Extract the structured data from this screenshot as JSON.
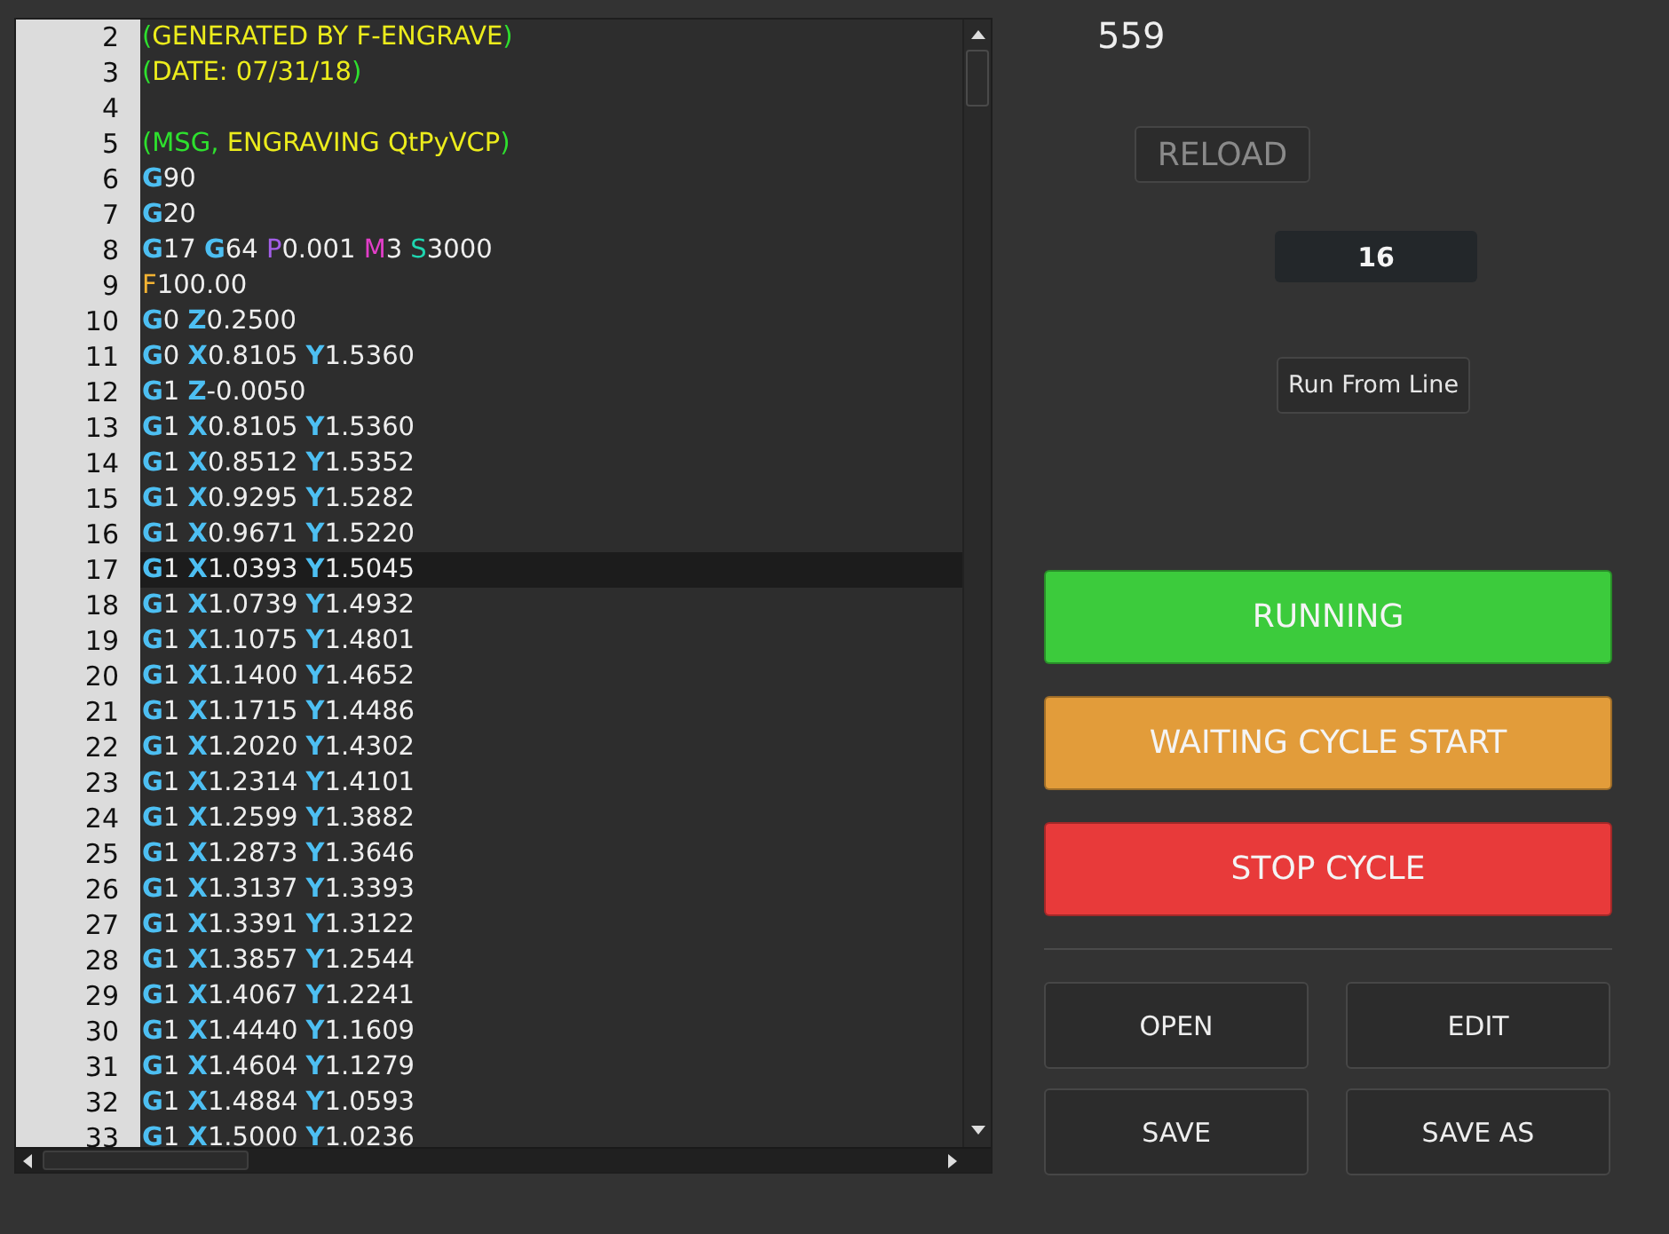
{
  "editor": {
    "lines": [
      {
        "number": "2",
        "selected": false,
        "tokens": [
          {
            "kind": "paren",
            "text": "("
          },
          {
            "kind": "comment",
            "text": "GENERATED BY F-ENGRAVE"
          },
          {
            "kind": "paren",
            "text": ")"
          }
        ]
      },
      {
        "number": "3",
        "selected": false,
        "tokens": [
          {
            "kind": "paren",
            "text": "("
          },
          {
            "kind": "comment",
            "text": "DATE: 07/31/18"
          },
          {
            "kind": "paren",
            "text": ")"
          }
        ]
      },
      {
        "number": "4",
        "selected": false
      },
      {
        "number": "5",
        "selected": false,
        "tokens": [
          {
            "kind": "paren",
            "text": "(MSG,"
          },
          {
            "kind": "comment",
            "text": " ENGRAVING QtPyVCP"
          },
          {
            "kind": "paren",
            "text": ")"
          }
        ]
      },
      {
        "number": "6",
        "selected": false,
        "tokens": [
          {
            "kind": "axis",
            "text": "G"
          },
          {
            "kind": "value",
            "text": "90"
          }
        ]
      },
      {
        "number": "7",
        "selected": false,
        "tokens": [
          {
            "kind": "axis",
            "text": "G"
          },
          {
            "kind": "value",
            "text": "20"
          }
        ]
      },
      {
        "number": "8",
        "selected": false,
        "tokens": [
          {
            "kind": "axis",
            "text": "G"
          },
          {
            "kind": "value",
            "text": "17 "
          },
          {
            "kind": "axis",
            "text": "G"
          },
          {
            "kind": "value",
            "text": "64 "
          },
          {
            "kind": "p",
            "text": "P"
          },
          {
            "kind": "value",
            "text": "0.001 "
          },
          {
            "kind": "m",
            "text": "M"
          },
          {
            "kind": "value",
            "text": "3 "
          },
          {
            "kind": "s",
            "text": "S"
          },
          {
            "kind": "value",
            "text": "3000"
          }
        ]
      },
      {
        "number": "9",
        "selected": false,
        "tokens": [
          {
            "kind": "f",
            "text": "F"
          },
          {
            "kind": "value",
            "text": "100.00"
          }
        ]
      },
      {
        "number": "10",
        "selected": false,
        "tokens": [
          {
            "kind": "axis",
            "text": "G"
          },
          {
            "kind": "value",
            "text": "0 "
          },
          {
            "kind": "axis",
            "text": "Z"
          },
          {
            "kind": "value",
            "text": "0.2500"
          }
        ]
      },
      {
        "number": "11",
        "selected": false,
        "tokens": [
          {
            "kind": "axis",
            "text": "G"
          },
          {
            "kind": "value",
            "text": "0 "
          },
          {
            "kind": "axis",
            "text": "X"
          },
          {
            "kind": "value",
            "text": "0.8105 "
          },
          {
            "kind": "axis",
            "text": "Y"
          },
          {
            "kind": "value",
            "text": "1.5360"
          }
        ]
      },
      {
        "number": "12",
        "selected": false,
        "tokens": [
          {
            "kind": "axis",
            "text": "G"
          },
          {
            "kind": "value",
            "text": "1 "
          },
          {
            "kind": "axis",
            "text": "Z"
          },
          {
            "kind": "value",
            "text": "-0.0050"
          }
        ]
      },
      {
        "number": "13",
        "selected": false,
        "tokens": [
          {
            "kind": "axis",
            "text": "G"
          },
          {
            "kind": "value",
            "text": "1 "
          },
          {
            "kind": "axis",
            "text": "X"
          },
          {
            "kind": "value",
            "text": "0.8105 "
          },
          {
            "kind": "axis",
            "text": "Y"
          },
          {
            "kind": "value",
            "text": "1.5360"
          }
        ]
      },
      {
        "number": "14",
        "selected": false,
        "tokens": [
          {
            "kind": "axis",
            "text": "G"
          },
          {
            "kind": "value",
            "text": "1 "
          },
          {
            "kind": "axis",
            "text": "X"
          },
          {
            "kind": "value",
            "text": "0.8512 "
          },
          {
            "kind": "axis",
            "text": "Y"
          },
          {
            "kind": "value",
            "text": "1.5352"
          }
        ]
      },
      {
        "number": "15",
        "selected": false,
        "tokens": [
          {
            "kind": "axis",
            "text": "G"
          },
          {
            "kind": "value",
            "text": "1 "
          },
          {
            "kind": "axis",
            "text": "X"
          },
          {
            "kind": "value",
            "text": "0.9295 "
          },
          {
            "kind": "axis",
            "text": "Y"
          },
          {
            "kind": "value",
            "text": "1.5282"
          }
        ]
      },
      {
        "number": "16",
        "selected": false,
        "tokens": [
          {
            "kind": "axis",
            "text": "G"
          },
          {
            "kind": "value",
            "text": "1 "
          },
          {
            "kind": "axis",
            "text": "X"
          },
          {
            "kind": "value",
            "text": "0.9671 "
          },
          {
            "kind": "axis",
            "text": "Y"
          },
          {
            "kind": "value",
            "text": "1.5220"
          }
        ]
      },
      {
        "number": "17",
        "selected": true,
        "tokens": [
          {
            "kind": "axis",
            "text": "G"
          },
          {
            "kind": "value",
            "text": "1 "
          },
          {
            "kind": "axis",
            "text": "X"
          },
          {
            "kind": "value",
            "text": "1.0393 "
          },
          {
            "kind": "axis",
            "text": "Y"
          },
          {
            "kind": "value",
            "text": "1.5045"
          }
        ]
      },
      {
        "number": "18",
        "selected": false,
        "tokens": [
          {
            "kind": "axis",
            "text": "G"
          },
          {
            "kind": "value",
            "text": "1 "
          },
          {
            "kind": "axis",
            "text": "X"
          },
          {
            "kind": "value",
            "text": "1.0739 "
          },
          {
            "kind": "axis",
            "text": "Y"
          },
          {
            "kind": "value",
            "text": "1.4932"
          }
        ]
      },
      {
        "number": "19",
        "selected": false,
        "tokens": [
          {
            "kind": "axis",
            "text": "G"
          },
          {
            "kind": "value",
            "text": "1 "
          },
          {
            "kind": "axis",
            "text": "X"
          },
          {
            "kind": "value",
            "text": "1.1075 "
          },
          {
            "kind": "axis",
            "text": "Y"
          },
          {
            "kind": "value",
            "text": "1.4801"
          }
        ]
      },
      {
        "number": "20",
        "selected": false,
        "tokens": [
          {
            "kind": "axis",
            "text": "G"
          },
          {
            "kind": "value",
            "text": "1 "
          },
          {
            "kind": "axis",
            "text": "X"
          },
          {
            "kind": "value",
            "text": "1.1400 "
          },
          {
            "kind": "axis",
            "text": "Y"
          },
          {
            "kind": "value",
            "text": "1.4652"
          }
        ]
      },
      {
        "number": "21",
        "selected": false,
        "tokens": [
          {
            "kind": "axis",
            "text": "G"
          },
          {
            "kind": "value",
            "text": "1 "
          },
          {
            "kind": "axis",
            "text": "X"
          },
          {
            "kind": "value",
            "text": "1.1715 "
          },
          {
            "kind": "axis",
            "text": "Y"
          },
          {
            "kind": "value",
            "text": "1.4486"
          }
        ]
      },
      {
        "number": "22",
        "selected": false,
        "tokens": [
          {
            "kind": "axis",
            "text": "G"
          },
          {
            "kind": "value",
            "text": "1 "
          },
          {
            "kind": "axis",
            "text": "X"
          },
          {
            "kind": "value",
            "text": "1.2020 "
          },
          {
            "kind": "axis",
            "text": "Y"
          },
          {
            "kind": "value",
            "text": "1.4302"
          }
        ]
      },
      {
        "number": "23",
        "selected": false,
        "tokens": [
          {
            "kind": "axis",
            "text": "G"
          },
          {
            "kind": "value",
            "text": "1 "
          },
          {
            "kind": "axis",
            "text": "X"
          },
          {
            "kind": "value",
            "text": "1.2314 "
          },
          {
            "kind": "axis",
            "text": "Y"
          },
          {
            "kind": "value",
            "text": "1.4101"
          }
        ]
      },
      {
        "number": "24",
        "selected": false,
        "tokens": [
          {
            "kind": "axis",
            "text": "G"
          },
          {
            "kind": "value",
            "text": "1 "
          },
          {
            "kind": "axis",
            "text": "X"
          },
          {
            "kind": "value",
            "text": "1.2599 "
          },
          {
            "kind": "axis",
            "text": "Y"
          },
          {
            "kind": "value",
            "text": "1.3882"
          }
        ]
      },
      {
        "number": "25",
        "selected": false,
        "tokens": [
          {
            "kind": "axis",
            "text": "G"
          },
          {
            "kind": "value",
            "text": "1 "
          },
          {
            "kind": "axis",
            "text": "X"
          },
          {
            "kind": "value",
            "text": "1.2873 "
          },
          {
            "kind": "axis",
            "text": "Y"
          },
          {
            "kind": "value",
            "text": "1.3646"
          }
        ]
      },
      {
        "number": "26",
        "selected": false,
        "tokens": [
          {
            "kind": "axis",
            "text": "G"
          },
          {
            "kind": "value",
            "text": "1 "
          },
          {
            "kind": "axis",
            "text": "X"
          },
          {
            "kind": "value",
            "text": "1.3137 "
          },
          {
            "kind": "axis",
            "text": "Y"
          },
          {
            "kind": "value",
            "text": "1.3393"
          }
        ]
      },
      {
        "number": "27",
        "selected": false,
        "tokens": [
          {
            "kind": "axis",
            "text": "G"
          },
          {
            "kind": "value",
            "text": "1 "
          },
          {
            "kind": "axis",
            "text": "X"
          },
          {
            "kind": "value",
            "text": "1.3391 "
          },
          {
            "kind": "axis",
            "text": "Y"
          },
          {
            "kind": "value",
            "text": "1.3122"
          }
        ]
      },
      {
        "number": "28",
        "selected": false,
        "tokens": [
          {
            "kind": "axis",
            "text": "G"
          },
          {
            "kind": "value",
            "text": "1 "
          },
          {
            "kind": "axis",
            "text": "X"
          },
          {
            "kind": "value",
            "text": "1.3857 "
          },
          {
            "kind": "axis",
            "text": "Y"
          },
          {
            "kind": "value",
            "text": "1.2544"
          }
        ]
      },
      {
        "number": "29",
        "selected": false,
        "tokens": [
          {
            "kind": "axis",
            "text": "G"
          },
          {
            "kind": "value",
            "text": "1 "
          },
          {
            "kind": "axis",
            "text": "X"
          },
          {
            "kind": "value",
            "text": "1.4067 "
          },
          {
            "kind": "axis",
            "text": "Y"
          },
          {
            "kind": "value",
            "text": "1.2241"
          }
        ]
      },
      {
        "number": "30",
        "selected": false,
        "tokens": [
          {
            "kind": "axis",
            "text": "G"
          },
          {
            "kind": "value",
            "text": "1 "
          },
          {
            "kind": "axis",
            "text": "X"
          },
          {
            "kind": "value",
            "text": "1.4440 "
          },
          {
            "kind": "axis",
            "text": "Y"
          },
          {
            "kind": "value",
            "text": "1.1609"
          }
        ]
      },
      {
        "number": "31",
        "selected": false,
        "tokens": [
          {
            "kind": "axis",
            "text": "G"
          },
          {
            "kind": "value",
            "text": "1 "
          },
          {
            "kind": "axis",
            "text": "X"
          },
          {
            "kind": "value",
            "text": "1.4604 "
          },
          {
            "kind": "axis",
            "text": "Y"
          },
          {
            "kind": "value",
            "text": "1.1279"
          }
        ]
      },
      {
        "number": "32",
        "selected": false,
        "tokens": [
          {
            "kind": "axis",
            "text": "G"
          },
          {
            "kind": "value",
            "text": "1 "
          },
          {
            "kind": "axis",
            "text": "X"
          },
          {
            "kind": "value",
            "text": "1.4884 "
          },
          {
            "kind": "axis",
            "text": "Y"
          },
          {
            "kind": "value",
            "text": "1.0593"
          }
        ]
      },
      {
        "number": "33",
        "selected": false,
        "tokens": [
          {
            "kind": "axis",
            "text": "G"
          },
          {
            "kind": "value",
            "text": "1 "
          },
          {
            "kind": "axis",
            "text": "X"
          },
          {
            "kind": "value",
            "text": "1.5000 "
          },
          {
            "kind": "axis",
            "text": "Y"
          },
          {
            "kind": "value",
            "text": "1.0236"
          }
        ]
      }
    ]
  },
  "line_count": "559",
  "reload_button": {
    "label": "RELOAD",
    "disabled": true
  },
  "line_field": {
    "value": "16"
  },
  "run_from_line_button": {
    "label": "Run From Line"
  },
  "status_buttons": [
    {
      "label": "RUNNING",
      "color": "#3ccb3c"
    },
    {
      "label": "WAITING CYCLE START",
      "color": "#e29c3a"
    },
    {
      "label": "STOP CYCLE",
      "color": "#e83a3a"
    }
  ],
  "file_buttons": [
    {
      "label": "OPEN"
    },
    {
      "label": "EDIT"
    },
    {
      "label": "SAVE"
    },
    {
      "label": "SAVE AS"
    }
  ]
}
